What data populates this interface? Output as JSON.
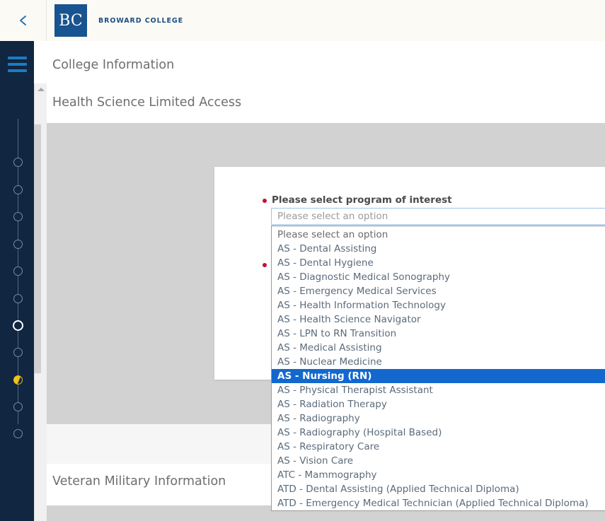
{
  "header": {
    "back_icon": "chevron-left-icon",
    "logo_initials": "BC",
    "brand_name": "BROWARD COLLEGE",
    "menu_icon": "hamburger-menu-icon"
  },
  "sidebar": {
    "scroll_up_icon": "caret-up-icon",
    "steps": [
      {
        "state": "incomplete"
      },
      {
        "state": "incomplete"
      },
      {
        "state": "incomplete"
      },
      {
        "state": "incomplete"
      },
      {
        "state": "incomplete"
      },
      {
        "state": "incomplete"
      },
      {
        "state": "current"
      },
      {
        "state": "incomplete"
      },
      {
        "state": "partial"
      },
      {
        "state": "incomplete"
      },
      {
        "state": "incomplete"
      }
    ],
    "colors": {
      "rail_background": "#102641",
      "current_step": "#ffffff",
      "partial_step": "#f2c21b",
      "menu_icon": "#1d7ac4"
    }
  },
  "main": {
    "section_college": "College Information",
    "section_health": "Health Science Limited Access",
    "section_veteran": "Veteran Military Information"
  },
  "form": {
    "field_label": "Please select program of interest",
    "required_marker": "required-bullet",
    "select_value": "",
    "select_placeholder": "Please select an option",
    "selected_option": "AS - Nursing (RN)",
    "options": [
      "Please select an option",
      "AS - Dental Assisting",
      "AS - Dental Hygiene",
      "AS - Diagnostic Medical Sonography",
      "AS - Emergency Medical Services",
      "AS - Health Information Technology",
      "AS - Health Science Navigator",
      "AS - LPN to RN Transition",
      "AS - Medical Assisting",
      "AS - Nuclear Medicine",
      "AS - Nursing (RN)",
      "AS - Physical Therapist Assistant",
      "AS - Radiation Therapy",
      "AS - Radiography",
      "AS - Radiography (Hospital Based)",
      "AS - Respiratory Care",
      "AS - Vision Care",
      "ATC - Mammography",
      "ATD - Dental Assisting (Applied Technical Diploma)",
      "ATD - Emergency Medical Technician (Applied Technical Diploma)"
    ],
    "colors": {
      "required": "#c8102e",
      "highlight": "#1368ce",
      "focus_border": "#9ec5e8"
    }
  }
}
